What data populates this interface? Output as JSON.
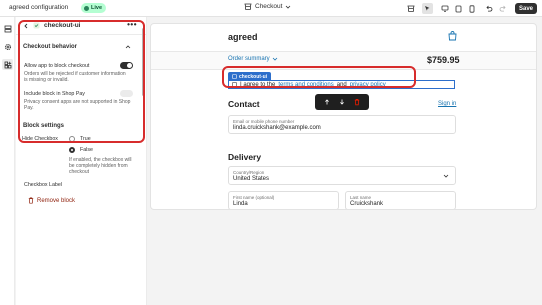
{
  "topbar": {
    "title": "agreed configuration",
    "status": "Live",
    "page_selector": "Checkout",
    "save_label": "Save"
  },
  "panel": {
    "block_name": "checkout-ui",
    "section_behavior": "Checkout behavior",
    "allow_block_label": "Allow app to block checkout",
    "allow_block_help": [
      "Orders will be rejected if customer information",
      "is missing or invalid."
    ],
    "allow_block_on": true,
    "shop_pay_label": "Include block in Shop Pay",
    "shop_pay_help": [
      "Privacy consent apps are not supported in Shop",
      "Pay."
    ],
    "shop_pay_on": false,
    "section_settings": "Block settings",
    "hide_checkbox_label": "Hide Checkbox",
    "option_true": "True",
    "option_false": "False",
    "hide_help": [
      "If enabled, the checkbox will",
      "be completely hidden from",
      "checkout"
    ],
    "selected_option": "False",
    "checkbox_label_label": "Checkbox Label",
    "remove_label": "Remove block"
  },
  "preview": {
    "store_name": "agreed",
    "order_summary": "Order summary",
    "total": "$759.95",
    "block_tag": "checkout-ui",
    "consent_prefix": "I agree to the",
    "terms_link": "terms and conditions",
    "consent_and": "and",
    "privacy_link": "privacy policy",
    "contact_heading": "Contact",
    "sign_in": "Sign in",
    "email_label": "Email or mobile phone number",
    "email_value": "linda.cruickshank@example.com",
    "delivery_heading": "Delivery",
    "country_label": "Country/Region",
    "country_value": "United States",
    "first_name_label": "First name (optional)",
    "first_name_value": "Linda",
    "last_name_label": "Last name",
    "last_name_value": "Cruickshank"
  },
  "colors": {
    "accent_blue": "#2c6ecb",
    "link_blue": "#1773b0",
    "live_green": "#29845a",
    "highlight_red": "#d72c2c",
    "danger": "#8e1f0b"
  },
  "icons": [
    "exit-icon",
    "chevron-down-icon",
    "store-icon",
    "select-icon",
    "desktop-icon",
    "tablet-icon",
    "mobile-icon",
    "undo-icon",
    "redo-icon",
    "sections-icon",
    "settings-icon",
    "apps-icon",
    "back-arrow-icon",
    "app-block-icon",
    "more-icon",
    "chevron-up-icon",
    "delete-icon",
    "bag-icon",
    "move-up-icon",
    "move-down-icon"
  ]
}
